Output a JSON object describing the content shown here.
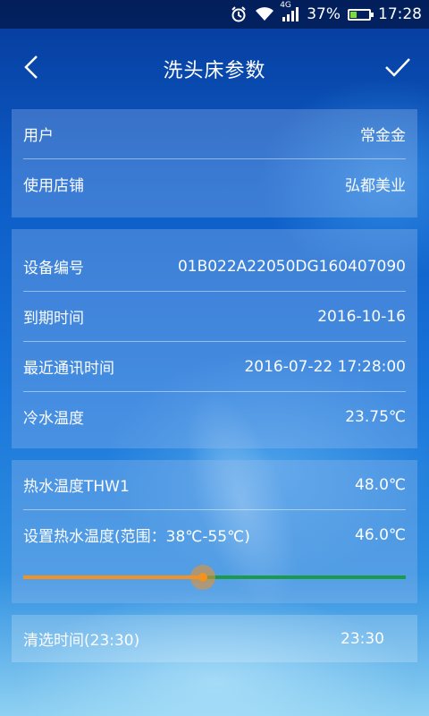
{
  "status_bar": {
    "battery_percent": "37%",
    "time": "17:28",
    "network_label": "4G",
    "icons": [
      "alarm-icon",
      "wifi-icon",
      "signal-icon",
      "battery-icon"
    ],
    "battery_level": 0.37
  },
  "nav": {
    "title": "洗头床参数",
    "back_icon": "chevron-left-icon",
    "confirm_icon": "check-icon"
  },
  "user_card": [
    {
      "label": "用户",
      "value": "常金金"
    },
    {
      "label": "使用店铺",
      "value": "弘都美业"
    }
  ],
  "device_card": [
    {
      "label": "设备编号",
      "value": "01B022A22050DG160407090"
    },
    {
      "label": "到期时间",
      "value": "2016-10-16"
    },
    {
      "label": "最近通讯时间",
      "value": "2016-07-22 17:28:00"
    },
    {
      "label": "冷水温度",
      "value": "23.75℃"
    }
  ],
  "hot_water_card": {
    "thw1": {
      "label": "热水温度THW1",
      "value": "48.0℃"
    },
    "set_temp": {
      "label": "设置热水温度(范围：38℃-55℃)",
      "value": "46.0℃"
    },
    "slider_fraction": 0.47,
    "colors": {
      "filled": "#f39221",
      "unfilled": "#1a9a4a"
    }
  },
  "cleaning_card": {
    "label": "清选时间(23:30)",
    "value": "23:30"
  }
}
